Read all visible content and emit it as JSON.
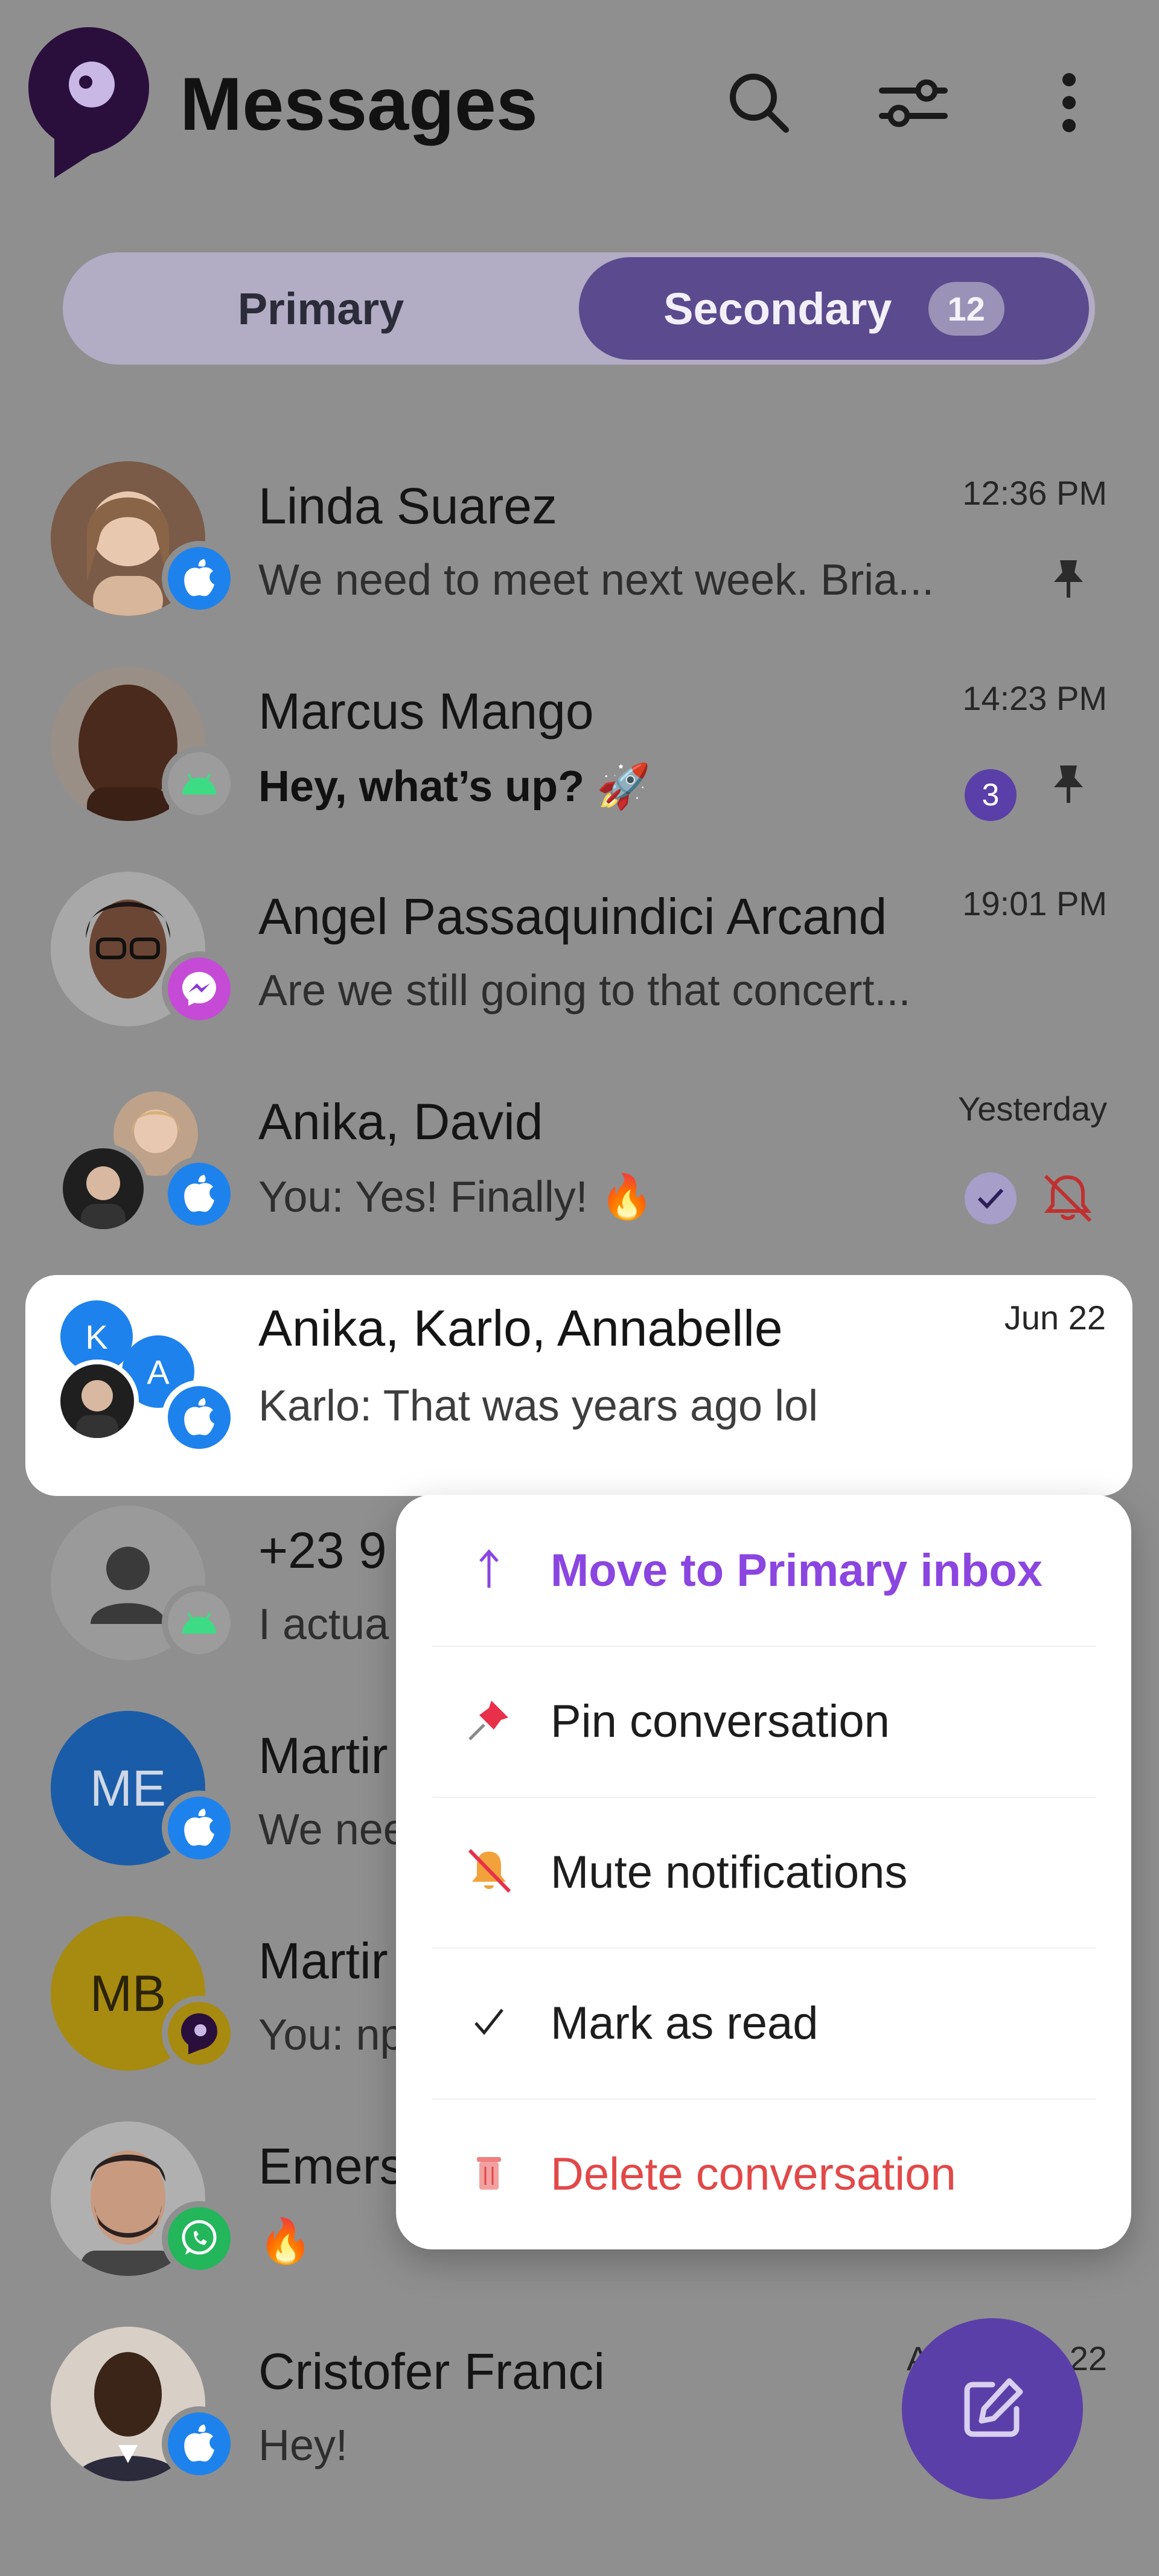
{
  "header": {
    "title": "Messages"
  },
  "tabs": {
    "primary_label": "Primary",
    "secondary_label": "Secondary",
    "secondary_count": "12",
    "active": "Secondary"
  },
  "conversations": [
    {
      "name": "Linda Suarez",
      "preview": "We need to meet next week. Bria...",
      "time": "12:36 PM",
      "platform": "imessage",
      "pinned": true
    },
    {
      "name": "Marcus Mango",
      "preview": "Hey, what’s up? 🚀",
      "time": "14:23 PM",
      "platform": "android",
      "pinned": true,
      "unread_count": "3"
    },
    {
      "name": "Angel Passaquindici Arcand",
      "preview": "Are we still going to that concert...",
      "time": "19:01 PM",
      "platform": "messenger"
    },
    {
      "name": "Anika, David",
      "preview": "You: Yes! Finally! 🔥",
      "time": "Yesterday",
      "platform": "imessage",
      "read": true,
      "muted": true
    },
    {
      "name": "Anika, Karlo, Annabelle",
      "preview": "Karlo: That was years ago lol",
      "time": "Jun 22",
      "platform": "imessage",
      "selected": true,
      "initials": [
        "K",
        "A"
      ]
    },
    {
      "name": "+23 9",
      "preview": "I actua",
      "platform": "android"
    },
    {
      "name": "Martir",
      "preview": "We nee",
      "platform": "imessage",
      "initials": "ME"
    },
    {
      "name": "Martir",
      "preview": "You: np",
      "platform": "app",
      "initials": "MB"
    },
    {
      "name": "Emers",
      "preview": "🔥",
      "platform": "whatsapp"
    },
    {
      "name": "Cristofer Franci",
      "preview": "Hey!",
      "time_fragments": [
        "A",
        "22"
      ],
      "platform": "imessage"
    }
  ],
  "context_menu": {
    "items": [
      {
        "label": "Move to Primary inbox",
        "icon": "arrow-up-icon"
      },
      {
        "label": "Pin conversation",
        "icon": "pushpin-icon"
      },
      {
        "label": "Mute notifications",
        "icon": "bell-slash-icon"
      },
      {
        "label": "Mark as read",
        "icon": "checkmark-icon"
      },
      {
        "label": "Delete conversation",
        "icon": "trash-icon"
      }
    ]
  },
  "colors": {
    "accent": "#5B3FA8",
    "menu_highlight": "#8B45E0",
    "destructive": "#E24848",
    "imessage_blue": "#1E82EC",
    "whatsapp_green": "#23B65A",
    "android_green": "#3DDC84"
  }
}
